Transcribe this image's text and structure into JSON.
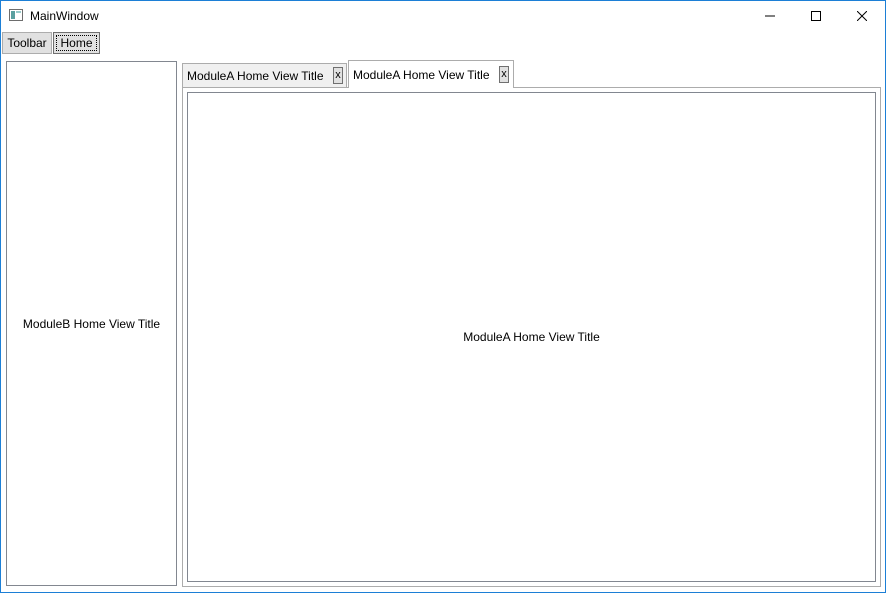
{
  "window": {
    "title": "MainWindow"
  },
  "toolbar": {
    "toolbar_label": "Toolbar",
    "home_label": "Home"
  },
  "left_region": {
    "text": "ModuleB Home View Title"
  },
  "tabs": [
    {
      "label": "ModuleA Home View Title",
      "close": "x",
      "selected": false
    },
    {
      "label": "ModuleA Home View Title",
      "close": "x",
      "selected": true
    }
  ],
  "content": {
    "text": "ModuleA Home View Title"
  }
}
